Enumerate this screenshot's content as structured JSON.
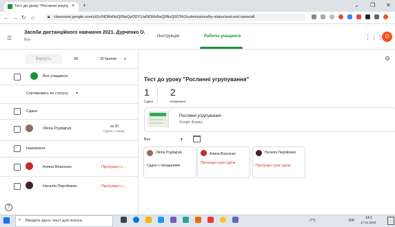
{
  "browser": {
    "tab_title": "Тест до уроку \"Рослинні угрупу",
    "tab_close": "×",
    "new_tab": "+",
    "minimize": "⌄",
    "restore": "❐",
    "close": "✕",
    "url": "classroom.google.com/u/0/c/NDMxNzQ0NzQyODY1/a/NDMxNzQ0NzQ0OTA1/submissions/by-status/and-sort-name/all"
  },
  "header": {
    "course_title": "Засоби дистанційного навчання 2021. Дурченко О.",
    "course_subtitle": "Всіх",
    "tab_instructions": "Инструкция",
    "tab_student_works": "Работы учащихся",
    "avatar_letter": "О"
  },
  "toolbar": {
    "return_label": "Вернуть",
    "points_label": "20 баллов"
  },
  "students_panel": {
    "all_students": "Все учащиеся",
    "sort_label": "Сортировать по статусу",
    "sections": [
      {
        "title": "Сдано",
        "students": [
          {
            "name": "Olena Pryjdajnyk",
            "grade": "из 20",
            "status": "Сдано с опозд."
          }
        ]
      },
      {
        "title": "Назначено",
        "students": [
          {
            "name": "Алина Власенко",
            "status": "Пропущен с..."
          },
          {
            "name": "Наталія Пергійович",
            "status": "Пропущен с..."
          }
        ]
      }
    ]
  },
  "assignment": {
    "title": "Тест до уроку \"Рослинні угрупування\"",
    "stats": [
      {
        "value": "1",
        "label": "Сдано"
      },
      {
        "value": "2",
        "label": "Назначено"
      }
    ],
    "attachment_title": "Рослинні угрупування",
    "attachment_type": "Google Формы",
    "filter_label": "Все",
    "cards": [
      {
        "name": "Olena Pryjdajnyk",
        "status": "Сдано с опозданием"
      },
      {
        "name": "Алина Власенко",
        "status": "Пропущен срок сдачи"
      },
      {
        "name": "Наталія Пергійович",
        "status": "Пропущен срок сдачи"
      }
    ]
  },
  "help_icon": "?",
  "taskbar": {
    "search_placeholder": "Введите здесь текст для поиска",
    "weather": "-7°C",
    "lang": "УКР",
    "time": "14:1",
    "date": "17.01.2022"
  },
  "colors": {
    "accent": "#1e8e3e",
    "late": "#d93025",
    "avatar": "#f4511e"
  }
}
